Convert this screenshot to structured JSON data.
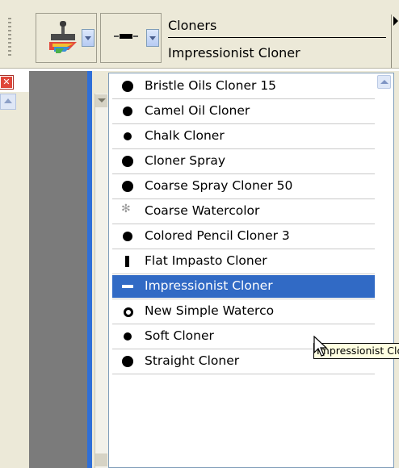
{
  "toolbar": {
    "brush_category": "Cloners",
    "brush_variant": "Impressionist Cloner",
    "icons": {
      "category_icon": "cloner-stamp-icon",
      "variant_icon": "brush-dab-icon"
    }
  },
  "brush_list": {
    "items": [
      {
        "label": "Bristle Oils Cloner 15",
        "icon": "round-dab-large"
      },
      {
        "label": "Camel Oil Cloner",
        "icon": "round-dab-medium"
      },
      {
        "label": "Chalk Cloner",
        "icon": "round-dab-small"
      },
      {
        "label": "Cloner Spray",
        "icon": "round-dab-large"
      },
      {
        "label": "Coarse Spray Cloner 50",
        "icon": "round-dab-large"
      },
      {
        "label": "Coarse Watercolor",
        "icon": "speckle-dab"
      },
      {
        "label": "Colored Pencil Cloner 3",
        "icon": "round-dab-medium"
      },
      {
        "label": "Flat Impasto Cloner",
        "icon": "flat-bar-dab"
      },
      {
        "label": "Impressionist Cloner",
        "icon": "dash-dab"
      },
      {
        "label": "New Simple Waterco",
        "icon": "ring-dab"
      },
      {
        "label": "Soft Cloner",
        "icon": "round-dab-small"
      },
      {
        "label": "Straight Cloner",
        "icon": "round-dab-large"
      }
    ],
    "selected": "Impressionist Cloner"
  },
  "tooltip": {
    "text": "Impressionist Clo"
  },
  "colors": {
    "selection": "#316ac5",
    "tooltip_bg": "#ffffe1",
    "close_button": "#e0463a"
  }
}
